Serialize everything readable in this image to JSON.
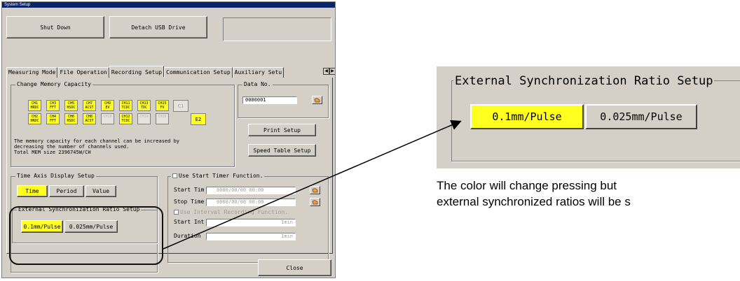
{
  "window": {
    "title": "System Setup"
  },
  "top_buttons": {
    "shut_down": "Shut Down",
    "detach_usb": "Detach USB Drive"
  },
  "tabs": [
    {
      "label": "Measuring Mode",
      "active": false
    },
    {
      "label": "File Operation",
      "active": false
    },
    {
      "label": "Recording Setup",
      "active": true
    },
    {
      "label": "Communication Setup",
      "active": false
    },
    {
      "label": "Auxiliary Setu",
      "active": false
    }
  ],
  "scroll": {
    "left": "◀",
    "right": "▶"
  },
  "memory": {
    "title": "Change Memory Capacity",
    "row1": [
      {
        "top": "CH1",
        "bottom": "HRDC",
        "on": true
      },
      {
        "top": "CH3",
        "bottom": "FFT",
        "on": true
      },
      {
        "top": "CH5",
        "bottom": "HSDC",
        "on": true
      },
      {
        "top": "CH7",
        "bottom": "ACST",
        "on": true
      },
      {
        "top": "CH9",
        "bottom": "EV",
        "on": true
      },
      {
        "top": "CH11",
        "bottom": "TCDC",
        "on": true
      },
      {
        "top": "CH13",
        "bottom": "TDC",
        "on": true
      },
      {
        "top": "CH15",
        "bottom": "FV",
        "on": true
      }
    ],
    "row2": [
      {
        "top": "CH2",
        "bottom": "HRDC",
        "on": true
      },
      {
        "top": "CH4",
        "bottom": "FFT",
        "on": true
      },
      {
        "top": "CH6",
        "bottom": "HSDC",
        "on": true
      },
      {
        "top": "CH8",
        "bottom": "ACST",
        "on": true
      },
      {
        "top": "CH10",
        "bottom": "",
        "on": false
      },
      {
        "top": "CH12",
        "bottom": "TCDC",
        "on": true
      },
      {
        "top": "CH14",
        "bottom": "",
        "on": false
      },
      {
        "top": "CH16",
        "bottom": "",
        "on": false
      }
    ],
    "c1_label": "C1",
    "e2_label": "E2",
    "description_lines": [
      "The memory capacity for each channel can be increased by",
      "decreasing the number of channels used.",
      "Total MEM size 2396745W/CH"
    ]
  },
  "data_no": {
    "title": "Data No.",
    "value": "0000001"
  },
  "print_setup": "Print Setup",
  "speed_table_setup": "Speed Table Setup",
  "time_axis": {
    "title": "Time Axis Display Setup",
    "options": [
      "Time",
      "Period",
      "Value"
    ],
    "selected": "Time"
  },
  "ext_sync": {
    "title": "External Synchronization Ratio Setup",
    "options": [
      "0.1mm/Pulse",
      "0.025mm/Pulse"
    ],
    "selected": "0.1mm/Pulse"
  },
  "start_timer": {
    "checkbox_label": "Use Start Timer Function.",
    "start_label": "Start Tim",
    "start_value": "0000/00/00 00:00",
    "stop_label": "Stop Time",
    "stop_value": "0000/00/00 00:00",
    "interval_label": "Use Interval Recording Function.",
    "start_int_label": "Start Int",
    "start_int_unit": "1min",
    "duration_label": "Duration",
    "duration_unit": "1min"
  },
  "close_label": "Close",
  "zoom": {
    "title": "External Synchronization Ratio Setup",
    "options": [
      "0.1mm/Pulse",
      "0.025mm/Pulse"
    ],
    "selected": "0.1mm/Pulse"
  },
  "caption_lines": [
    "The color will change pressing but",
    "external synchronized ratios will be s"
  ],
  "colors": {
    "dialog_bg": "#d4d0c8",
    "selected_yellow": "#ffff20",
    "title_bar": "#0a246a"
  }
}
